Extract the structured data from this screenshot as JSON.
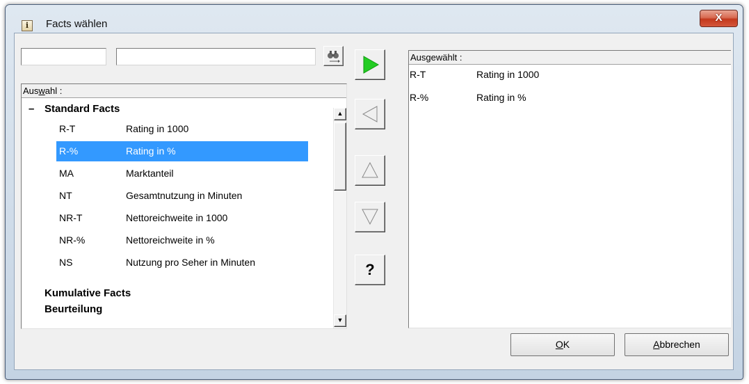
{
  "window": {
    "title": "Facts wählen",
    "app_icon_glyph": "i",
    "close_glyph": "X"
  },
  "search": {
    "field1_value": "",
    "field2_value": "",
    "button_icon": "binoculars-icon"
  },
  "left_list": {
    "header_prefix": "Aus",
    "header_underlined": "w",
    "header_suffix": "ahl :",
    "groups": [
      {
        "toggle": "–",
        "label": "Standard Facts",
        "items": [
          {
            "code": "R-T",
            "name": "Rating in 1000",
            "selected": false
          },
          {
            "code": "R-%",
            "name": "Rating in %",
            "selected": true
          },
          {
            "code": "MA",
            "name": "Marktanteil",
            "selected": false
          },
          {
            "code": "NT",
            "name": "Gesamtnutzung in Minuten",
            "selected": false
          },
          {
            "code": "NR-T",
            "name": "Nettoreichweite in 1000",
            "selected": false
          },
          {
            "code": "NR-%",
            "name": "Nettoreichweite in %",
            "selected": false
          },
          {
            "code": "NS",
            "name": "Nutzung pro Seher in Minuten",
            "selected": false
          }
        ]
      },
      {
        "label": "Kumulative Facts"
      },
      {
        "label": "Beurteilung"
      }
    ]
  },
  "scrollbar": {
    "up_glyph": "▲",
    "down_glyph": "▼"
  },
  "middle_buttons": {
    "add_icon": "play-right-icon",
    "remove_icon": "triangle-left-icon",
    "up_icon": "triangle-up-icon",
    "down_icon": "triangle-down-icon",
    "help_label": "?"
  },
  "right_list": {
    "header_prefix": "Aus",
    "header_underlined": "g",
    "header_suffix": "ewählt :",
    "items": [
      {
        "code": "R-T",
        "name": "Rating in 1000"
      },
      {
        "code": "R-%",
        "name": "Rating in %"
      }
    ]
  },
  "footer": {
    "ok_underlined": "O",
    "ok_rest": "K",
    "cancel_underlined": "A",
    "cancel_rest": "bbrechen"
  },
  "colors": {
    "selection": "#3399ff",
    "add_arrow": "#22cc22",
    "close_button": "#c3391d"
  }
}
